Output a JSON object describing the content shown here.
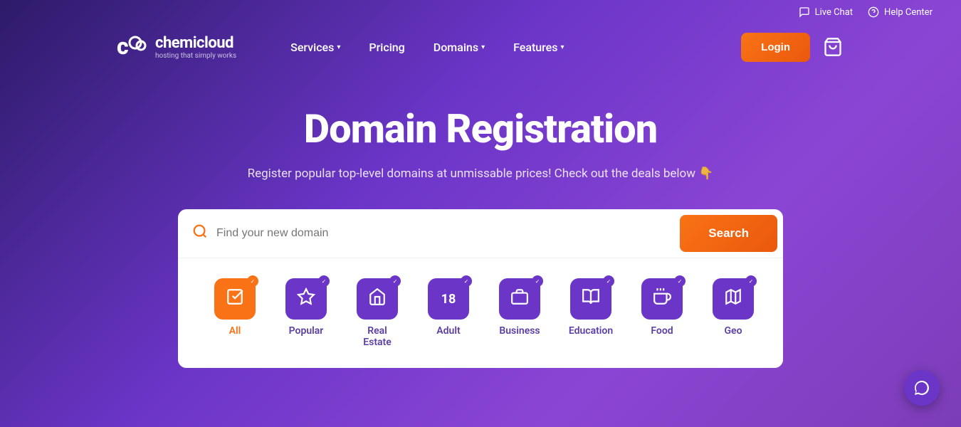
{
  "topbar": {
    "livechat": "Live Chat",
    "helpcenter": "Help Center"
  },
  "logo": {
    "name": "chemicloud",
    "tagline": "hosting that simply works"
  },
  "nav": {
    "services": "Services",
    "pricing": "Pricing",
    "domains": "Domains",
    "features": "Features",
    "login": "Login"
  },
  "hero": {
    "title": "Domain Registration",
    "subtitle": "Register popular top-level domains at unmissable prices! Check out the deals below 👇"
  },
  "search": {
    "placeholder": "Find your new domain",
    "button": "Search"
  },
  "categories": [
    {
      "id": "all",
      "label": "All",
      "icon": "☑",
      "active": true
    },
    {
      "id": "popular",
      "label": "Popular",
      "icon": "☆",
      "active": false
    },
    {
      "id": "realestate",
      "label": "Real Estate",
      "icon": "🏠",
      "active": false
    },
    {
      "id": "adult",
      "label": "Adult",
      "icon": "18",
      "active": false
    },
    {
      "id": "business",
      "label": "Business",
      "icon": "💼",
      "active": false
    },
    {
      "id": "education",
      "label": "Education",
      "icon": "📖",
      "active": false
    },
    {
      "id": "food",
      "label": "Food",
      "icon": "🍽",
      "active": false
    },
    {
      "id": "geo",
      "label": "Geo",
      "icon": "🗺",
      "active": false
    }
  ],
  "colors": {
    "orange": "#f97316",
    "purple": "#6b35c8",
    "bg_gradient_start": "#2d1b69",
    "bg_gradient_end": "#8b45d4"
  }
}
